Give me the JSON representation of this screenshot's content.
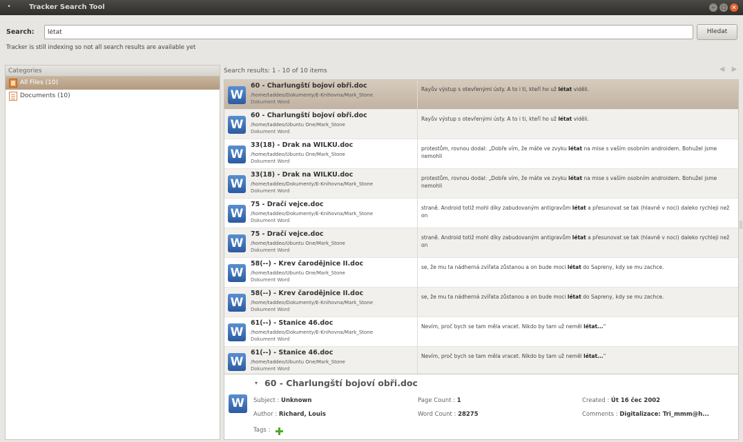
{
  "window": {
    "title": "Tracker Search Tool",
    "menu_glyph": "•",
    "controls": {
      "minimize": "–",
      "maximize": "□",
      "close": "×"
    }
  },
  "search": {
    "label": "Search:",
    "value": "létat",
    "clear_icon": "broom-icon",
    "button_label": "Hledat"
  },
  "status": {
    "indexing_note": "Tracker is still indexing so not all search results are available yet"
  },
  "categories": {
    "header": "Categories",
    "items": [
      {
        "label": "All Files (10)",
        "icon": "all-files-icon",
        "selected": true
      },
      {
        "label": "Documents (10)",
        "icon": "document-icon",
        "selected": false
      }
    ]
  },
  "results": {
    "summary": "Search results: 1 - 10 of 10 items",
    "nav_prev_icon": "arrow-left-icon",
    "nav_next_icon": "arrow-right-icon",
    "icon_letter": "W",
    "items": [
      {
        "title": "60 - Charlungští bojoví obři.doc",
        "path": "/home/taddeo/Dokumenty/E-Knihovna/Mark_Stone",
        "type": "Dokument Word",
        "snippet_before": "Rayův výstup s otevřenými ústy. A to i ti, kteří ho už ",
        "snippet_match": "létat",
        "snippet_after": " viděli."
      },
      {
        "title": "60 - Charlungští bojoví obři.doc",
        "path": "/home/taddeo/Ubuntu One/Mark_Stone",
        "type": "Dokument Word",
        "snippet_before": "Rayův výstup s otevřenými ústy. A to i ti, kteří ho už ",
        "snippet_match": "létat",
        "snippet_after": " viděli."
      },
      {
        "title": "33(18) - Drak na WILKU.doc",
        "path": "/home/taddeo/Ubuntu One/Mark_Stone",
        "type": "Dokument Word",
        "snippet_before": " protestům, rovnou dodal: „Dobře vím, že máte ve zvyku ",
        "snippet_match": "létat",
        "snippet_after": " na mise s vaším osobním androidem. Bohužel jsme nemohli"
      },
      {
        "title": "33(18) - Drak na WILKU.doc",
        "path": "/home/taddeo/Dokumenty/E-Knihovna/Mark_Stone",
        "type": "Dokument Word",
        "snippet_before": "protestům, rovnou dodal: „Dobře vím, že máte ve zvyku ",
        "snippet_match": "létat",
        "snippet_after": " na mise s vaším osobním androidem. Bohužel jsme nemohli"
      },
      {
        "title": "75 - Dračí vejce.doc",
        "path": "/home/taddeo/Dokumenty/E-Knihovna/Mark_Stone",
        "type": "Dokument Word",
        "snippet_before": " straně. Android totiž mohl díky zabudovaným antigravům ",
        "snippet_match": "létat",
        "snippet_after": " a přesunovat se tak (hlavně v noci) daleko rychleji než on"
      },
      {
        "title": "75 - Dračí vejce.doc",
        "path": "/home/taddeo/Ubuntu One/Mark_Stone",
        "type": "Dokument Word",
        "snippet_before": "straně. Android totiž mohl díky zabudovaným antigravům ",
        "snippet_match": "létat",
        "snippet_after": " a přesunovat se tak (hlavně v noci) daleko rychleji než on"
      },
      {
        "title": "58(--) - Krev čarodějnice II.doc",
        "path": "/home/taddeo/Ubuntu One/Mark_Stone",
        "type": "Dokument Word",
        "snippet_before": "se, že mu ta nádherná zvířata zůstanou a on bude moci ",
        "snippet_match": "létat",
        "snippet_after": " do Sapreny, kdy se mu zachce."
      },
      {
        "title": "58(--) - Krev čarodějnice II.doc",
        "path": "/home/taddeo/Dokumenty/E-Knihovna/Mark_Stone",
        "type": "Dokument Word",
        "snippet_before": "se, že mu ta nádherná zvířata zůstanou a on bude moci ",
        "snippet_match": "létat",
        "snippet_after": " do Sapreny, kdy se mu zachce."
      },
      {
        "title": "61(--) - Stanice 46.doc",
        "path": "/home/taddeo/Dokumenty/E-Knihovna/Mark_Stone",
        "type": "Dokument Word",
        "snippet_before": "Nevím, proč bych se tam měla vracet. Nikdo by tam už neměl ",
        "snippet_match": "létat...",
        "snippet_after": "“"
      },
      {
        "title": "61(--) - Stanice 46.doc",
        "path": "/home/taddeo/Ubuntu One/Mark_Stone",
        "type": "Dokument Word",
        "snippet_before": "Nevím, proč bych se tam měla vracet. Nikdo by tam už neměl ",
        "snippet_match": "létat...",
        "snippet_after": "“"
      }
    ]
  },
  "details": {
    "expander": "▾",
    "title": "60 - Charlungští bojoví obři.doc",
    "icon_letter": "W",
    "subject_label": "Subject : ",
    "subject_value": "Unknown",
    "author_label": "Author : ",
    "author_value": "Richard, Louis",
    "page_count_label": "Page Count : ",
    "page_count_value": "1",
    "word_count_label": "Word Count : ",
    "word_count_value": "28275",
    "created_label": "Created : ",
    "created_value": "Út 16 čec 2002",
    "comments_label": "Comments : ",
    "comments_value": "Digitalizace: Tri_mmm@h...",
    "tags_label": "Tags : ",
    "tags_add_icon": "add-tag-icon"
  },
  "colors": {
    "titlebar": "#3c3b37",
    "selection": "#c6b7a5",
    "category_selected": "#bba386",
    "word_icon": "#2b5aa0",
    "close_button": "#e2622f"
  }
}
